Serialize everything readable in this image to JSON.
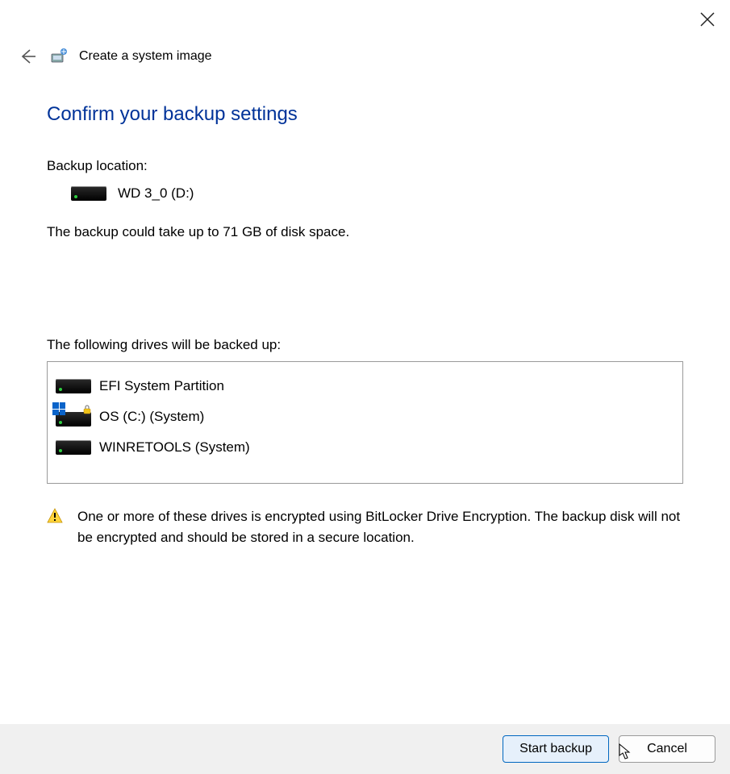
{
  "window": {
    "title": "Create a system image"
  },
  "page": {
    "heading": "Confirm your backup settings",
    "backup_location_label": "Backup location:",
    "backup_location_drive": "WD 3_0 (D:)",
    "size_note": "The backup could take up to 71 GB of disk space.",
    "drives_heading": "The following drives will be backed up:",
    "drives": [
      {
        "name": "EFI System Partition",
        "icon": "drive",
        "encrypted": false
      },
      {
        "name": "OS (C:) (System)",
        "icon": "drive-locked",
        "encrypted": true
      },
      {
        "name": "WINRETOOLS (System)",
        "icon": "drive",
        "encrypted": false
      }
    ],
    "warning_text": "One or more of these drives is encrypted using BitLocker Drive Encryption. The backup disk will not be encrypted and should be stored in a secure location."
  },
  "footer": {
    "primary_button": "Start backup",
    "cancel_button": "Cancel"
  }
}
